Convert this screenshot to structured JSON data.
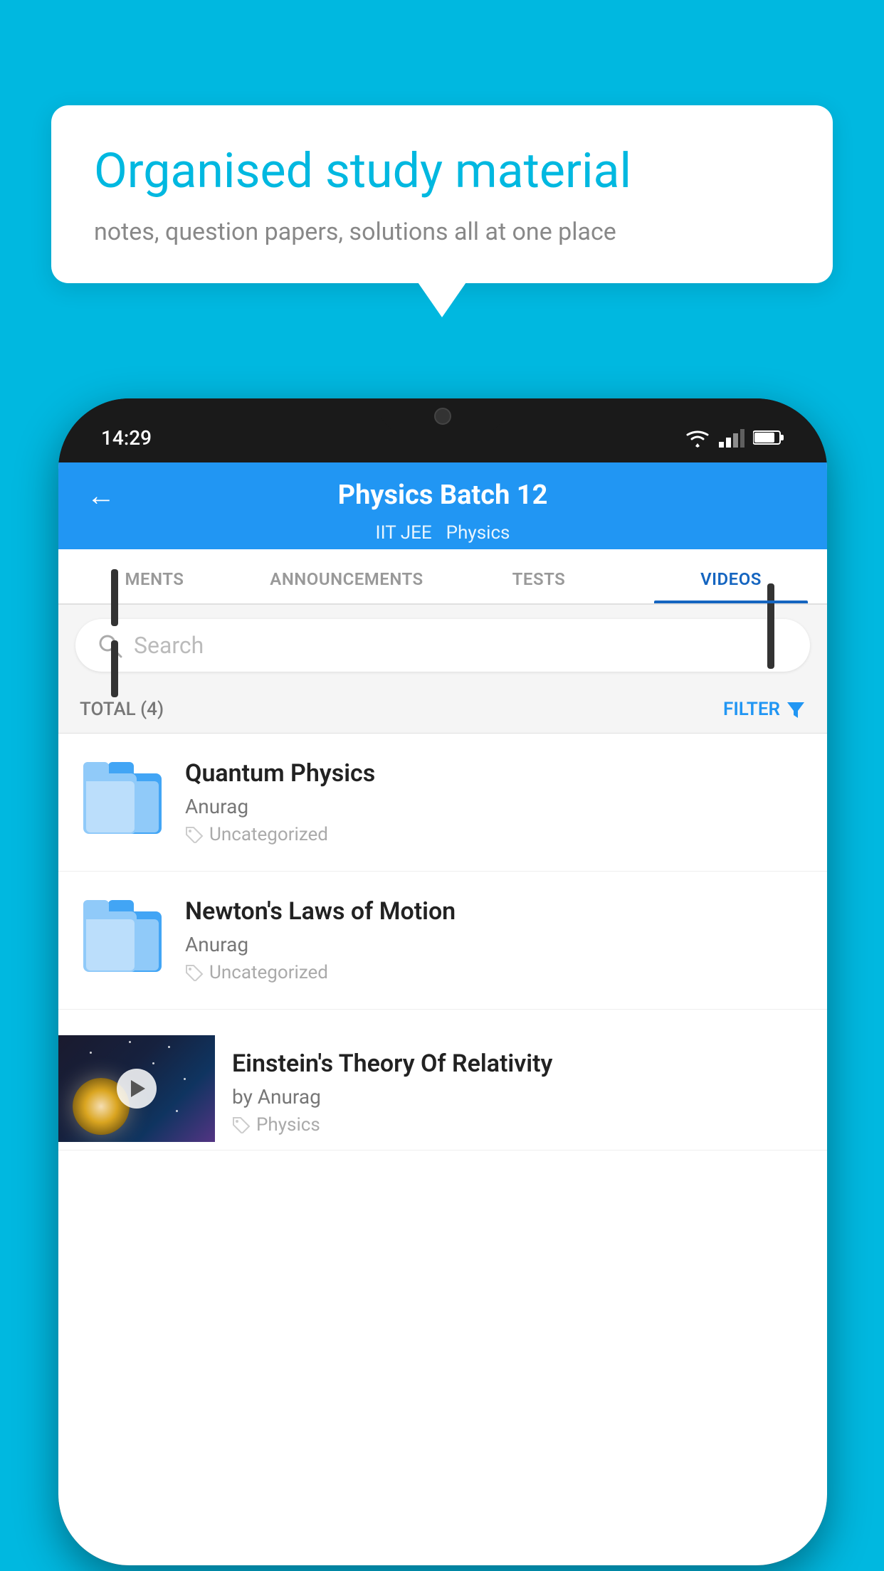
{
  "background_color": "#00B8E0",
  "speech_bubble": {
    "title": "Organised study material",
    "subtitle": "notes, question papers, solutions all at one place"
  },
  "phone": {
    "status_bar": {
      "time": "14:29",
      "icons": [
        "wifi",
        "signal",
        "battery"
      ]
    },
    "header": {
      "title": "Physics Batch 12",
      "subtitle_left": "IIT JEE",
      "subtitle_right": "Physics",
      "back_button": "←"
    },
    "tabs": [
      {
        "label": "MENTS",
        "active": false
      },
      {
        "label": "ANNOUNCEMENTS",
        "active": false
      },
      {
        "label": "TESTS",
        "active": false
      },
      {
        "label": "VIDEOS",
        "active": true
      }
    ],
    "search": {
      "placeholder": "Search"
    },
    "filter": {
      "total_label": "TOTAL (4)",
      "filter_button": "FILTER"
    },
    "videos": [
      {
        "id": 1,
        "title": "Quantum Physics",
        "author": "Anurag",
        "tag": "Uncategorized",
        "thumb_type": "folder"
      },
      {
        "id": 2,
        "title": "Newton's Laws of Motion",
        "author": "Anurag",
        "tag": "Uncategorized",
        "thumb_type": "folder"
      },
      {
        "id": 3,
        "title": "Einstein's Theory Of Relativity",
        "author": "by Anurag",
        "tag": "Physics",
        "thumb_type": "image"
      }
    ]
  }
}
